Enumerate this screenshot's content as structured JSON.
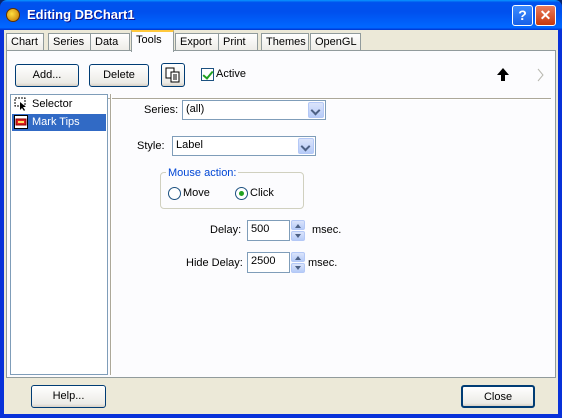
{
  "window": {
    "title": "Editing DBChart1"
  },
  "tabs": [
    "Chart",
    "Series",
    "Data",
    "Tools",
    "Export",
    "Print",
    "Themes",
    "OpenGL"
  ],
  "active_tab": "Tools",
  "toolbar": {
    "add_label": "Add...",
    "delete_label": "Delete",
    "active_label": "Active",
    "active_checked": true
  },
  "tools_list": [
    {
      "label": "Selector",
      "icon": "selector-icon",
      "selected": false
    },
    {
      "label": "Mark Tips",
      "icon": "mark-tips-icon",
      "selected": true
    }
  ],
  "settings": {
    "series_label": "Series:",
    "series_value": "(all)",
    "style_label": "Style:",
    "style_value": "Label",
    "mouse_action_title": "Mouse action:",
    "move_label": "Move",
    "click_label": "Click",
    "selected_action": "Click",
    "delay_label": "Delay:",
    "delay_value": "500",
    "hide_delay_label": "Hide Delay:",
    "hide_delay_value": "2500",
    "msec_label": "msec."
  },
  "footer": {
    "help_label": "Help...",
    "close_label": "Close"
  },
  "colors": {
    "title_bar": "#0053ee",
    "selection": "#316ac5",
    "dialog_bg": "#ece9d8",
    "group_title": "#0046d5"
  }
}
